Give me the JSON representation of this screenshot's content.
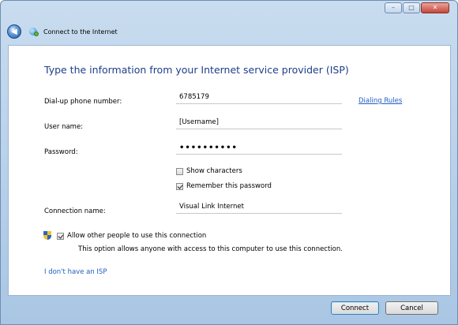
{
  "window": {
    "nav_title": "Connect to the Internet"
  },
  "caption_buttons": {
    "minimize": "–",
    "maximize": "□",
    "close": "✕"
  },
  "main": {
    "heading": "Type the information from your Internet service provider (ISP)",
    "phone_label": "Dial-up phone number:",
    "phone_value": "6785179",
    "dialing_rules": "Dialing Rules",
    "username_label": "User name:",
    "username_value": "[Username]",
    "password_label": "Password:",
    "password_value": "••••••••••",
    "show_characters": "Show characters",
    "remember_password": "Remember this password",
    "connection_name_label": "Connection name:",
    "connection_name_value": "Visual Link Internet",
    "allow_others": "Allow other people to use this connection",
    "allow_desc": "This option allows anyone with access to this computer to use this connection.",
    "no_isp": "I don't have an ISP",
    "checks": {
      "show_characters": false,
      "remember_password": true,
      "allow_others": true
    }
  },
  "footer": {
    "connect": "Connect",
    "cancel": "Cancel"
  }
}
